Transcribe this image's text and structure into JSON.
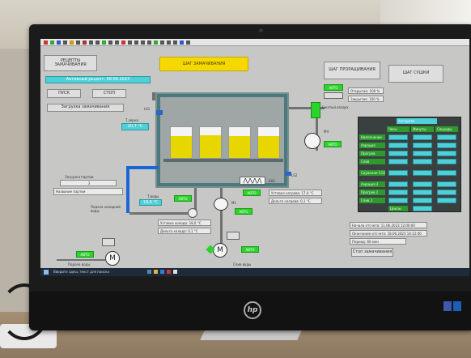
{
  "app": {
    "yellow_banner": "ШАГ ЗАМАЧИВАНИЯ",
    "recipes_button": "РЕЦЕПТЫ ЗАМАЧИВАНИЯ",
    "step_germination": "ШАГ ПРОРАЩИВАНИЯ",
    "step_drying": "ШАГ СУШКИ",
    "active_recipe": "Активный рецепт: 08.06.2023",
    "start_button": "ПУСК",
    "stop_button": "СТОП",
    "load_button": "Загрузка замачивания",
    "brand_logo": "hp"
  },
  "tank": {
    "level_label": "LS1",
    "low_level_label": "LS2",
    "heater_label": "EH1",
    "temp_label": "Т,зерна",
    "temp_value": "20,7 °С",
    "water_temp_label": "Т,воды",
    "water_temp_value": "19,6 °С",
    "baskets": [
      {
        "fill_pct": 72
      },
      {
        "fill_pct": 75
      },
      {
        "fill_pct": 72
      },
      {
        "fill_pct": 72
      }
    ]
  },
  "air": {
    "label": "Сжатый воздух",
    "valve_mode": "АВТО",
    "fan_label": "М4",
    "fan_mode": "АВТО",
    "opening_label": "Открытие: 100 %",
    "closing_label": "Закрытие: 100 %"
  },
  "grain": {
    "label": "Загрузка партии",
    "value": "3",
    "select": "Название партии"
  },
  "cold_water": {
    "label": "Подача холодной воды",
    "valve_mode": "АВТО",
    "setpoint": "Уставка холода: 18,0 °С",
    "delta": "Дельта холода: 0,1 °С"
  },
  "heater": {
    "mode": "АВТО",
    "setpoint": "Уставка нагрева: 17,0 °С",
    "delta": "Дельта нагрева: 0,1 °С"
  },
  "pumps": {
    "m1_label": "М1",
    "m1_mode": "АВТО",
    "drain_label": "Слив воды",
    "supply_label": "Подача воды",
    "left_mode": "АВТО",
    "drain_mode": "АВТО",
    "motor_glyph": "M"
  },
  "schedule": {
    "header": "Алгоритм",
    "col_hours": "Часы",
    "col_minutes": "Минуты",
    "col_seconds": "Секунды",
    "rows": [
      "Наполнение",
      "Аэрация",
      "Прогрев",
      "Слив",
      "Сдувание CO2",
      "Аэрация 2",
      "Прогрев 2",
      "Слив 2"
    ],
    "cycles_label": "Циклы",
    "extra_label": "Циклы"
  },
  "status": {
    "start": "Начало отсчета: 11.06.2023 12:00:00",
    "end": "Окончание отсчета: 18.06.2023 14:12:00",
    "period": "Период: 60 мин",
    "stop_button": "Стоп замачивания"
  },
  "taskbar": {
    "search": "Введите здесь текст для поиска"
  }
}
